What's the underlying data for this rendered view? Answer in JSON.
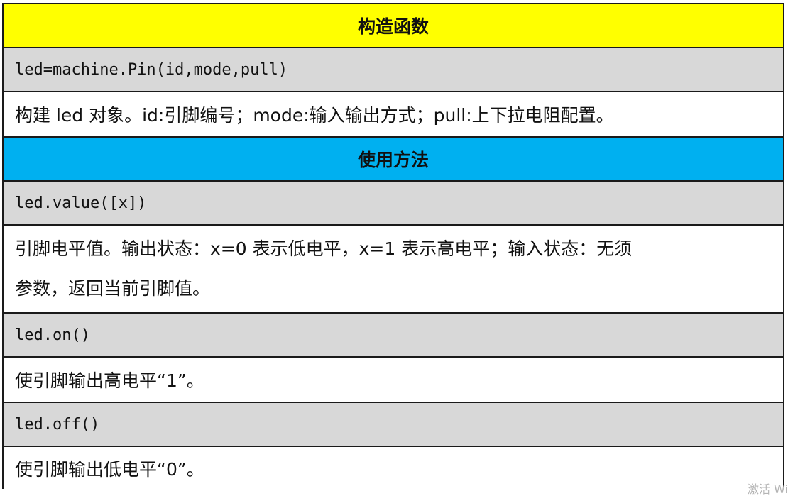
{
  "sections": [
    {
      "header": "构造函数",
      "header_color": "#ffff00",
      "entries": [
        {
          "code": "led=machine.Pin(id,mode,pull)",
          "description": "构建 led 对象。id:引脚编号；mode:输入输出方式；pull:上下拉电阻配置。"
        }
      ]
    },
    {
      "header": "使用方法",
      "header_color": "#00b0f0",
      "entries": [
        {
          "code": "led.value([x])",
          "description_lines": [
            "引脚电平值。输出状态：x=0 表示低电平，x=1 表示高电平；输入状态：无须",
            "参数，返回当前引脚值。"
          ]
        },
        {
          "code": "led.on()",
          "description": "使引脚输出高电平“1”。"
        },
        {
          "code": "led.off()",
          "description": "使引脚输出低电平“0”。"
        }
      ]
    }
  ],
  "code_row_color": "#d8d8d8",
  "watermark": "激活 Wi"
}
